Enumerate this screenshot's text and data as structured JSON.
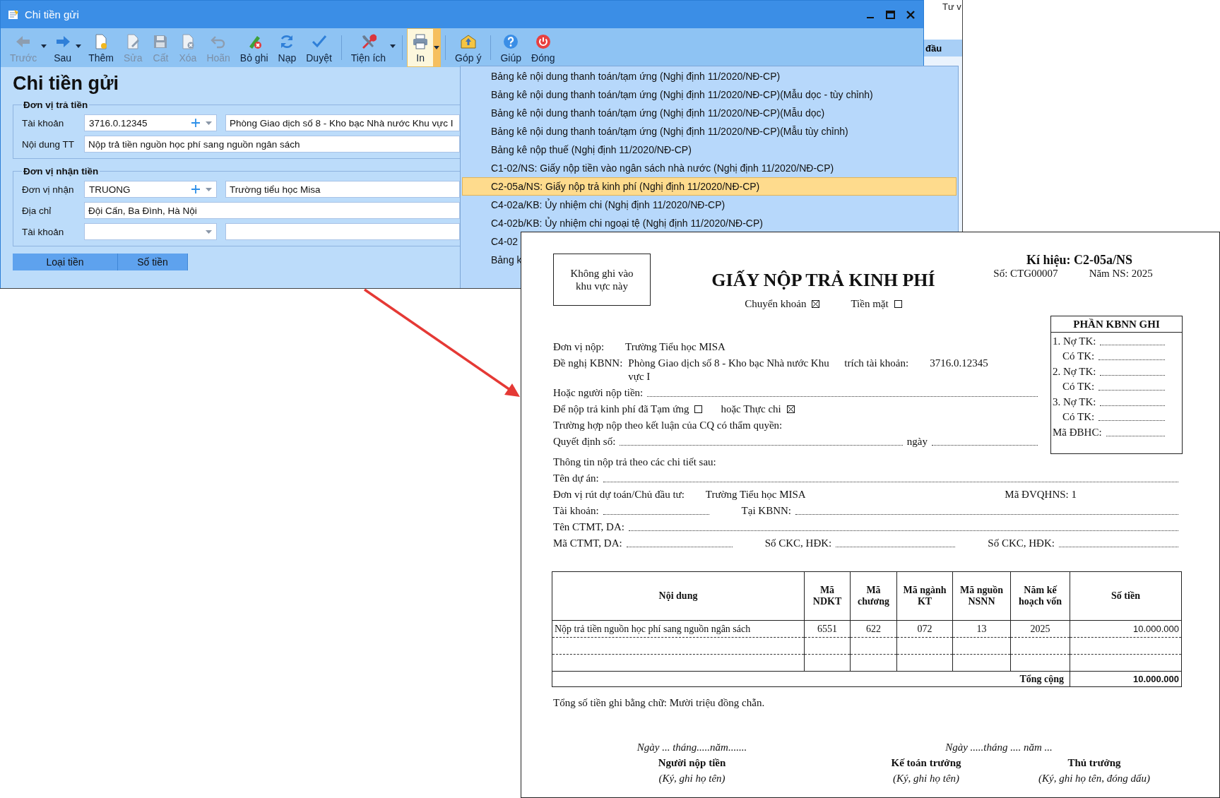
{
  "app_window": {
    "title": "Chi tiền gửi",
    "toolbar_groups": [
      [
        {
          "label": "Trước",
          "kind": "back",
          "disabled": true,
          "dropdown": true,
          "selected": false
        },
        {
          "label": "Sau",
          "kind": "forward",
          "disabled": false,
          "dropdown": true,
          "selected": false
        },
        {
          "label": "Thêm",
          "kind": "add",
          "disabled": false,
          "dropdown": false,
          "selected": false
        },
        {
          "label": "Sửa",
          "kind": "edit",
          "disabled": true,
          "dropdown": false,
          "selected": false
        },
        {
          "label": "Cất",
          "kind": "save",
          "disabled": true,
          "dropdown": false,
          "selected": false
        },
        {
          "label": "Xóa",
          "kind": "delete",
          "disabled": true,
          "dropdown": false,
          "selected": false
        },
        {
          "label": "Hoãn",
          "kind": "undo",
          "disabled": true,
          "dropdown": false,
          "selected": false
        },
        {
          "label": "Bỏ ghi",
          "kind": "unpost",
          "disabled": false,
          "dropdown": false,
          "selected": false
        },
        {
          "label": "Nạp",
          "kind": "reload",
          "disabled": false,
          "dropdown": false,
          "selected": false
        },
        {
          "label": "Duyệt",
          "kind": "approve",
          "disabled": false,
          "dropdown": false,
          "selected": false
        }
      ],
      [
        {
          "label": "Tiện ích",
          "kind": "tools",
          "disabled": false,
          "dropdown": true,
          "selected": false
        }
      ],
      [
        {
          "label": "In",
          "kind": "print",
          "disabled": false,
          "dropdown": true,
          "selected": true
        }
      ],
      [
        {
          "label": "Góp ý",
          "kind": "feedback",
          "disabled": false,
          "dropdown": false,
          "selected": false
        }
      ],
      [
        {
          "label": "Giúp",
          "kind": "help",
          "disabled": false,
          "dropdown": false,
          "selected": false
        },
        {
          "label": "Đóng",
          "kind": "power",
          "disabled": false,
          "dropdown": false,
          "selected": false
        }
      ]
    ],
    "form_title": "Chi tiền gửi",
    "groups": [
      {
        "legend": "Đơn vị trả tiền",
        "rows": [
          {
            "label": "Tài khoản",
            "kind": "combo",
            "value": "3716.0.12345",
            "add": true,
            "name": "Phòng Giao dịch số 8 - Kho bạc Nhà nước Khu vực I"
          },
          {
            "label": "Nội dung TT",
            "kind": "text",
            "value": "Nộp trả tiền nguồn học phí sang nguồn ngân sách"
          }
        ]
      },
      {
        "legend": "Đơn vị nhận tiền",
        "rows": [
          {
            "label": "Đơn vị nhận",
            "kind": "combo",
            "value": "TRUONG",
            "add": true,
            "name": "Trường tiểu học Misa"
          },
          {
            "label": "Địa chỉ",
            "kind": "text",
            "value": "Đội Cấn, Ba Đình, Hà Nội"
          },
          {
            "label": "Tài khoản",
            "kind": "combo",
            "add": false
          }
        ]
      }
    ],
    "grid_columns": [
      "Loại tiền",
      "Số tiền"
    ]
  },
  "background_window": {
    "title": "Tư v",
    "column_header": "đầu"
  },
  "print_menu": {
    "items": [
      {
        "label": "Bảng kê nội dung thanh toán/tạm ứng (Nghị định 11/2020/NĐ-CP)",
        "selected": false
      },
      {
        "label": "Bảng kê nội dung thanh toán/tạm ứng (Nghị định 11/2020/NĐ-CP)(Mẫu dọc - tùy chỉnh)",
        "selected": false
      },
      {
        "label": "Bảng kê nội dung thanh toán/tạm ứng (Nghị định 11/2020/NĐ-CP)(Mẫu dọc)",
        "selected": false
      },
      {
        "label": "Bảng kê nội dung thanh toán/tạm ứng (Nghị định 11/2020/NĐ-CP)(Mẫu tùy chỉnh)",
        "selected": false
      },
      {
        "label": "Bảng kê nộp thuế (Nghị định 11/2020/NĐ-CP)",
        "selected": false
      },
      {
        "label": "C1-02/NS: Giấy nộp tiền vào ngân sách nhà nước (Nghị định 11/2020/NĐ-CP)",
        "selected": false
      },
      {
        "label": "C2-05a/NS: Giấy nộp trả kinh phí (Nghị định 11/2020/NĐ-CP)",
        "selected": true
      },
      {
        "label": "C4-02a/KB: Ủy nhiệm chi (Nghị định 11/2020/NĐ-CP)",
        "selected": false
      },
      {
        "label": "C4-02b/KB: Ủy nhiệm chi ngoại tệ (Nghị định 11/2020/NĐ-CP)",
        "selected": false
      },
      {
        "label": "C4-02",
        "selected": false
      },
      {
        "label": "Bảng k",
        "selected": false
      }
    ]
  },
  "document": {
    "notice": "Không ghi vào khu vực này",
    "title": "GIẤY NỘP TRẢ KINH PHÍ",
    "form_code": "Kí hiệu: C2-05a/NS",
    "number": "Số: CTG00007",
    "budget_year": "Năm NS: 2025",
    "payment_methods": [
      {
        "label": "Chuyển khoản",
        "checked": true
      },
      {
        "label": "Tiền mặt",
        "checked": false
      }
    ],
    "treasury_box": {
      "title": "PHẦN KBNN GHI",
      "lines": [
        {
          "label": "1. Nợ TK:",
          "kind": "debit"
        },
        {
          "label": "Có TK:",
          "kind": "credit"
        },
        {
          "label": "2. Nợ TK:",
          "kind": "debit"
        },
        {
          "label": "Có TK:",
          "kind": "credit"
        },
        {
          "label": "3. Nợ TK:",
          "kind": "debit"
        },
        {
          "label": "Có TK:",
          "kind": "credit"
        },
        {
          "label": "Mã ĐBHC:",
          "kind": "code"
        }
      ]
    },
    "upper_lines": [
      [
        {
          "kind": "text",
          "text": "Đơn vị nộp:"
        },
        {
          "kind": "value",
          "text": "Trường Tiểu học MISA"
        }
      ],
      [
        {
          "kind": "text",
          "text": "Đề nghị KBNN:"
        },
        {
          "kind": "wrap",
          "text": "Phòng Giao dịch số 8 - Kho bạc Nhà nước Khu vực I"
        },
        {
          "kind": "text",
          "text": "trích tài khoản:"
        },
        {
          "kind": "value",
          "text": "3716.0.12345"
        }
      ],
      [
        {
          "kind": "text",
          "text": "Hoặc người nộp tiền:"
        },
        {
          "kind": "fill"
        }
      ],
      [
        {
          "kind": "check",
          "text": "Để nộp trả kinh phí đã Tạm ứng",
          "checked": false
        },
        {
          "kind": "check",
          "text": "hoặc Thực chi",
          "checked": true
        }
      ],
      [
        {
          "kind": "text",
          "text": "Trường hợp nộp theo kết luận của CQ có thẩm quyền:"
        }
      ],
      [
        {
          "kind": "text",
          "text": "Quyết  định  số:"
        },
        {
          "kind": "fill"
        },
        {
          "kind": "text",
          "text": "ngày"
        },
        {
          "kind": "short"
        }
      ]
    ],
    "lower_lines": [
      [
        {
          "kind": "text",
          "text": "Thông tin nộp trả theo các chi tiết sau:"
        }
      ],
      [
        {
          "kind": "text",
          "text": "Tên  dự  án:"
        },
        {
          "kind": "fill"
        }
      ],
      [
        {
          "kind": "text",
          "text": "Đơn vị rút dự toán/Chủ đầu tư:"
        },
        {
          "kind": "value",
          "text": "Trường Tiểu học MISA"
        },
        {
          "kind": "right",
          "text": "Mã ĐVQHNS: 1"
        }
      ],
      [
        {
          "kind": "text",
          "text": "Tài khoản:"
        },
        {
          "kind": "short"
        },
        {
          "kind": "spaced",
          "text": "Tại KBNN:"
        },
        {
          "kind": "fill"
        }
      ],
      [
        {
          "kind": "text",
          "text": "Tên CTMT, DA:"
        },
        {
          "kind": "fill"
        }
      ],
      [
        {
          "kind": "text",
          "text": "Mã CTMT, DA:"
        },
        {
          "kind": "short"
        },
        {
          "kind": "spaced",
          "text": "Số  CKC,  HĐK:"
        },
        {
          "kind": "fill"
        },
        {
          "kind": "spaced",
          "text": "Số  CKC,  HĐK:"
        },
        {
          "kind": "fill"
        }
      ]
    ],
    "table": {
      "columns": [
        "Nội dung",
        "Mã NDKT",
        "Mã chương",
        "Mã ngành KT",
        "Mã nguồn NSNN",
        "Năm kế hoạch vốn",
        "Số tiền"
      ],
      "rows": [
        {
          "cells": [
            "Nộp trả tiền nguồn học phí sang nguồn ngân sách",
            "6551",
            "622",
            "072",
            "13",
            "2025",
            "10.000.000"
          ]
        }
      ],
      "total_label": "Tổng cộng",
      "total": "10.000.000"
    },
    "amount_in_words": "Tổng số tiền ghi bằng chữ: Mười triệu đồng chẵn.",
    "dates": [
      "Ngày ... tháng.....năm.......",
      "Ngày .....tháng .... năm ..."
    ],
    "signatures": [
      {
        "role": "Người nộp tiền",
        "note": "(Ký, ghi họ tên)"
      },
      {
        "role": "Kế toán trưởng",
        "note": "(Ký, ghi họ tên)"
      },
      {
        "role": "Thủ trưởng",
        "note": "(Ký, ghi họ tên, đóng dấu)"
      }
    ]
  }
}
